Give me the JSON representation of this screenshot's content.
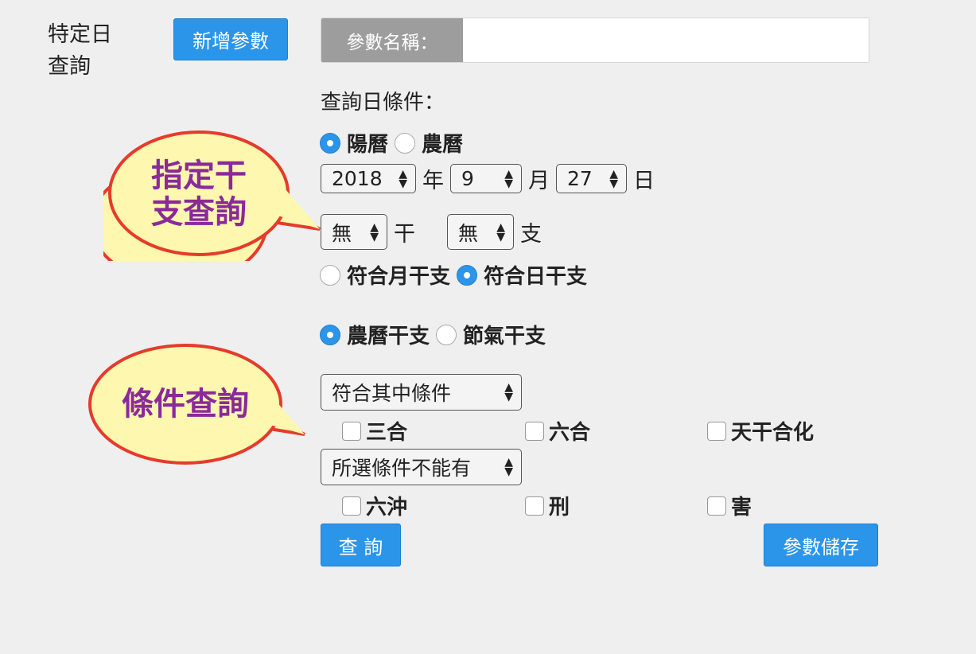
{
  "page": {
    "label_line1": "特定日",
    "label_line2": "查詢"
  },
  "toolbar": {
    "add_param_label": "新增參數"
  },
  "param": {
    "label": "參數名稱：",
    "value": ""
  },
  "query_date": {
    "title": "查詢日條件：",
    "calendar_options": [
      "陽曆",
      "農曆"
    ],
    "calendar_selected": "陽曆",
    "year": "2018",
    "year_unit": "年",
    "month": "9",
    "month_unit": "月",
    "day": "27",
    "day_unit": "日",
    "stem": "無",
    "stem_unit": "干",
    "branch": "無",
    "branch_unit": "支",
    "match_options": [
      "符合月干支",
      "符合日干支"
    ],
    "match_selected": "符合日干支"
  },
  "ganzhi_type": {
    "options": [
      "農曆干支",
      "節氣干支"
    ],
    "selected": "農曆干支"
  },
  "condition1": {
    "select": "符合其中條件",
    "checkboxes": [
      "三合",
      "六合",
      "天干合化"
    ]
  },
  "condition2": {
    "select": "所選條件不能有",
    "checkboxes": [
      "六沖",
      "刑",
      "害"
    ]
  },
  "actions": {
    "query_label": "查 詢",
    "save_label": "參數儲存"
  },
  "callouts": {
    "ganzhi_line1": "指定干",
    "ganzhi_line2": "支查詢",
    "condition": "條件查詢"
  },
  "colors": {
    "accent": "#2b95ea",
    "callout_fill": "#fdf7b0",
    "callout_border": "#e53b2c",
    "callout_text": "#8a2a9a"
  }
}
